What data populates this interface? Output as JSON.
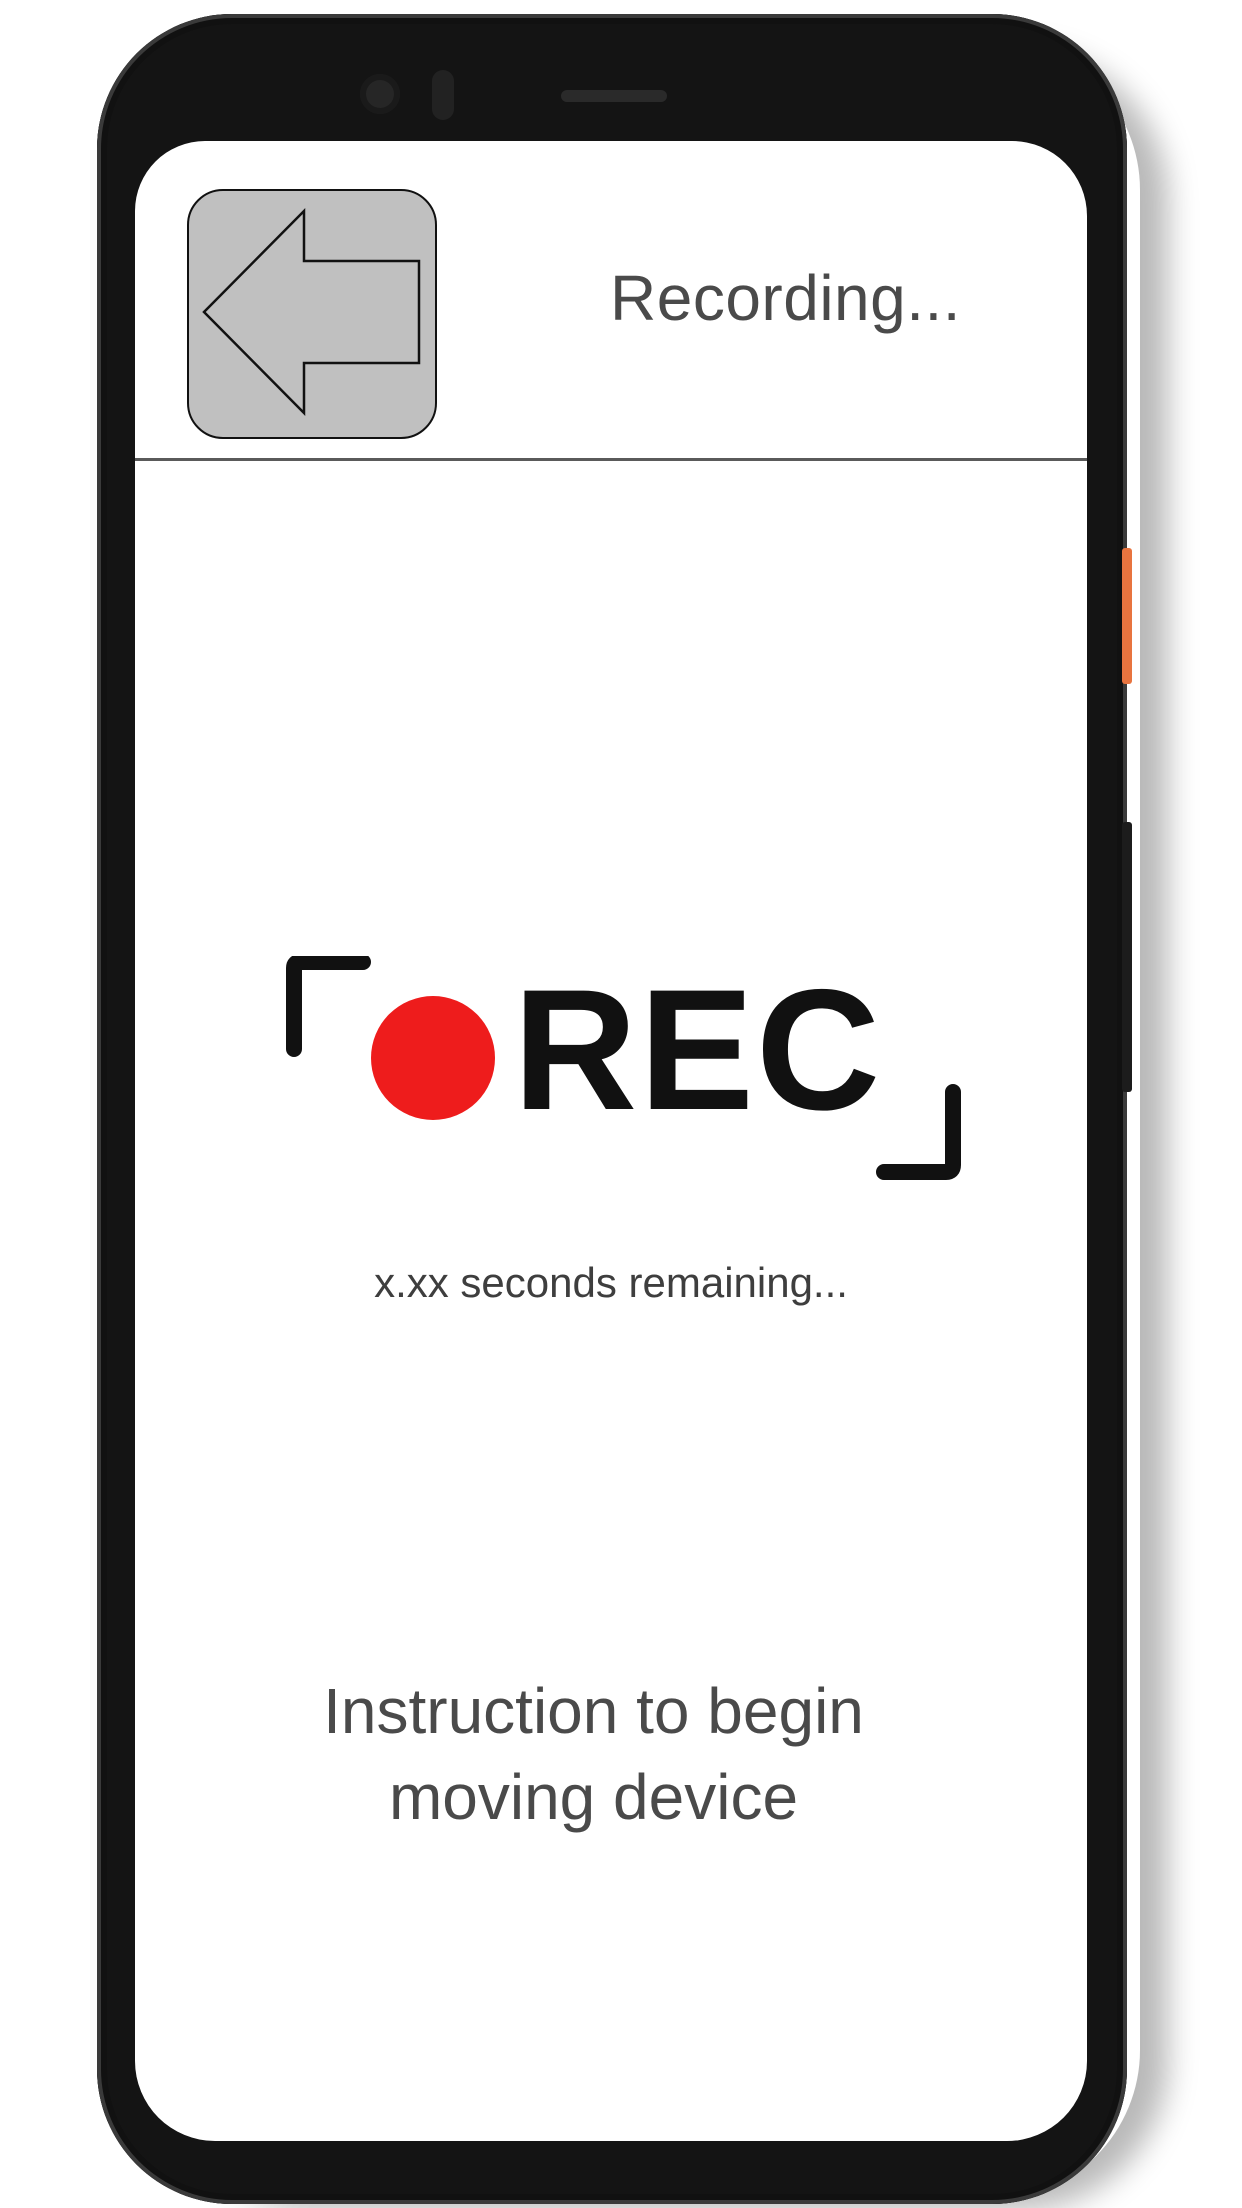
{
  "header": {
    "title": "Recording...",
    "back_icon": "back-arrow-icon"
  },
  "recording": {
    "badge_text": "REC",
    "indicator_color": "#ee1c1c",
    "remaining_text": "x.xx seconds remaining..."
  },
  "instruction": {
    "line1": "Instruction to begin",
    "line2": "moving device"
  },
  "colors": {
    "screen_background": "#ffffff",
    "back_button_fill": "#c0c0c0",
    "text": "#4a4a4a",
    "phone_frame": "#141414"
  }
}
